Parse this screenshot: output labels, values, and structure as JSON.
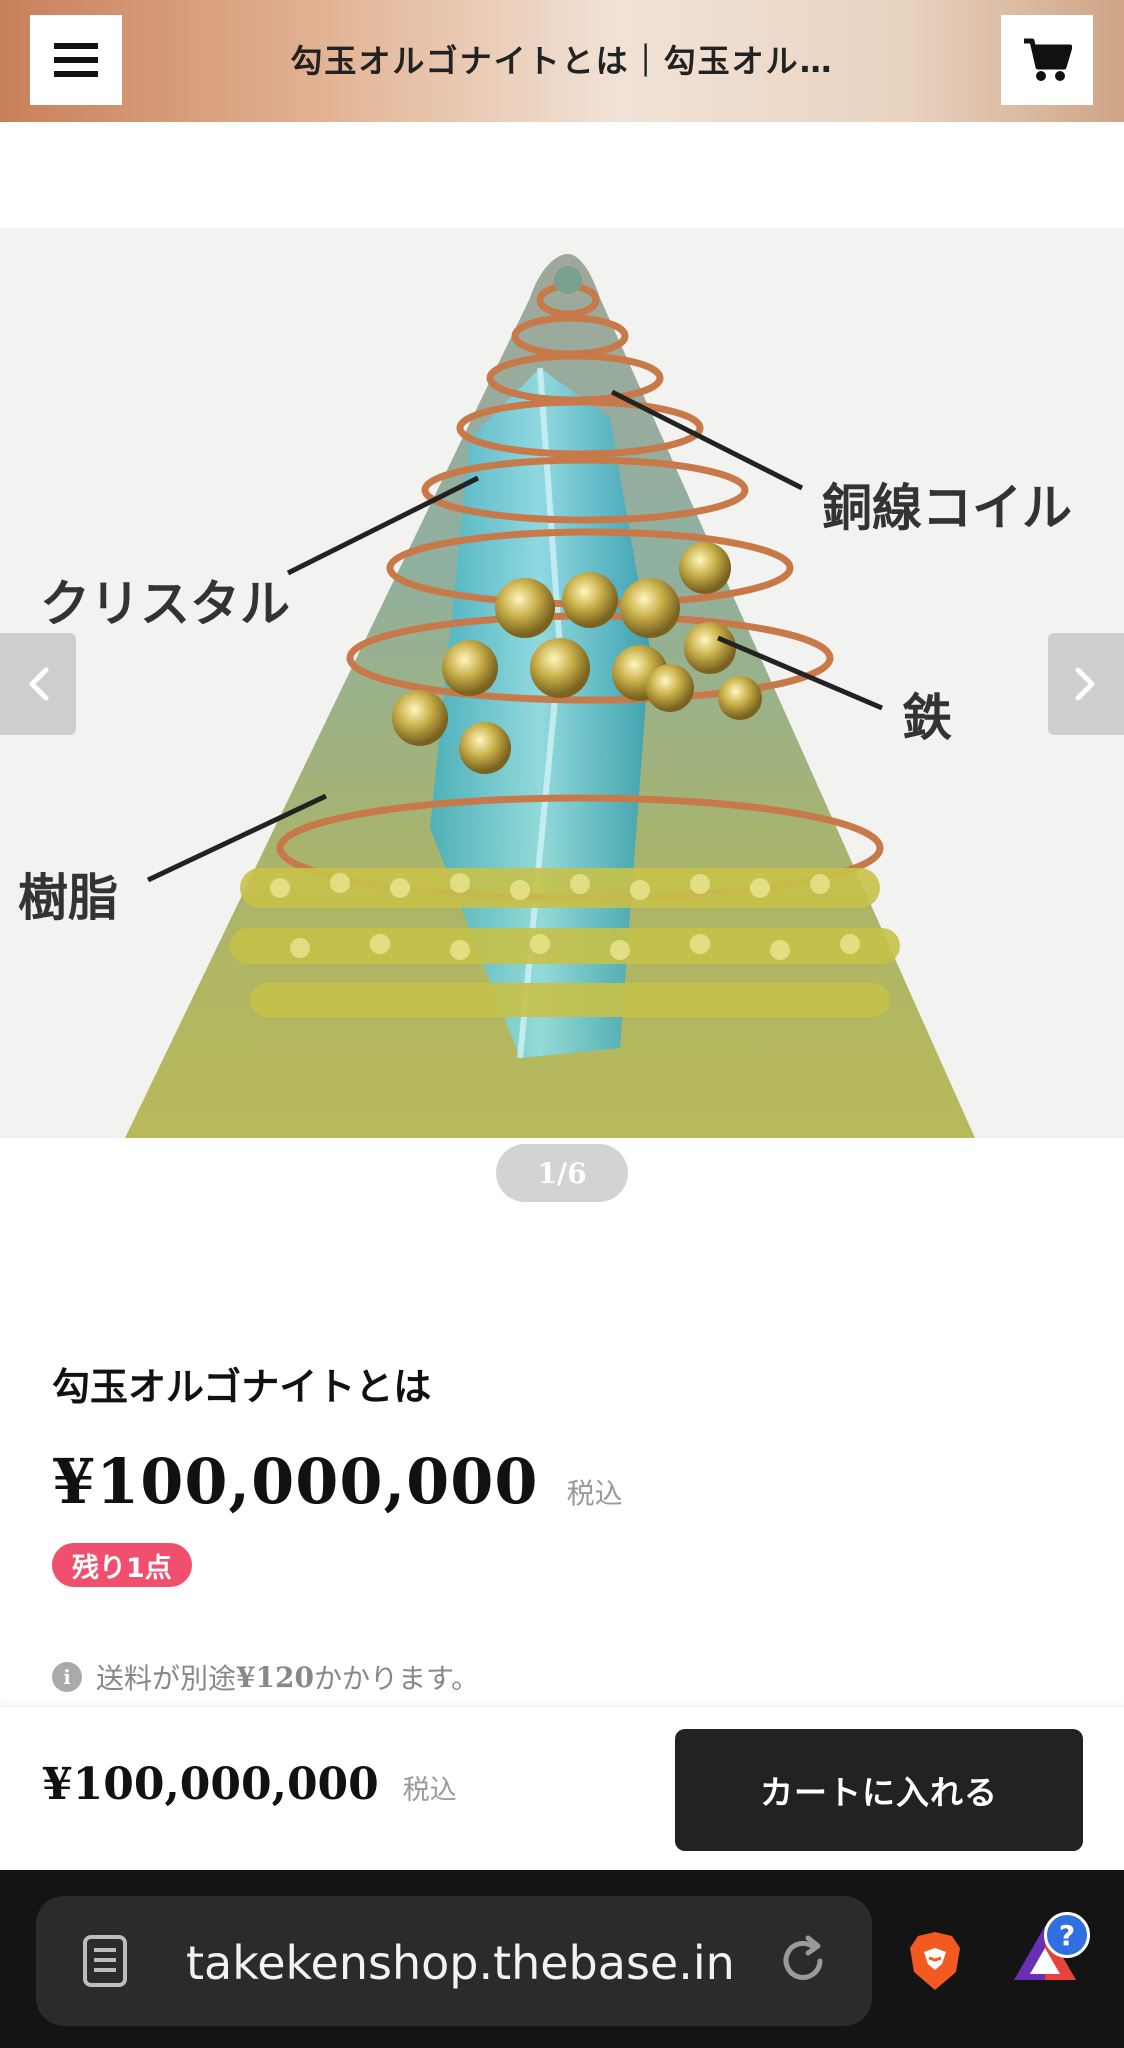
{
  "header": {
    "title": "勾玉オルゴナイトとは｜勾玉オル…",
    "menu_icon": "hamburger-menu-icon",
    "cart_icon": "shopping-cart-icon"
  },
  "gallery": {
    "labels": {
      "copper_coil": "銅線コイル",
      "crystal": "クリスタル",
      "iron": "鉄",
      "resin": "樹脂"
    },
    "counter": "1/6",
    "prev_icon": "chevron-left-icon",
    "next_icon": "chevron-right-icon"
  },
  "product": {
    "title": "勾玉オルゴナイトとは",
    "price": "¥100,000,000",
    "tax_label": "税込",
    "stock_badge": "残り1点",
    "shipping_prefix": "送料が別途",
    "shipping_fee": "¥120",
    "shipping_suffix": "かかります。"
  },
  "buybar": {
    "price": "¥100,000,000",
    "tax_label": "税込",
    "cart_button": "カートに入れる"
  },
  "browser": {
    "url": "takekenshop.thebase.in",
    "help_badge": "?"
  },
  "colors": {
    "badge": "#f0506e",
    "cart_button": "#222222",
    "browser_bar": "#141414"
  }
}
